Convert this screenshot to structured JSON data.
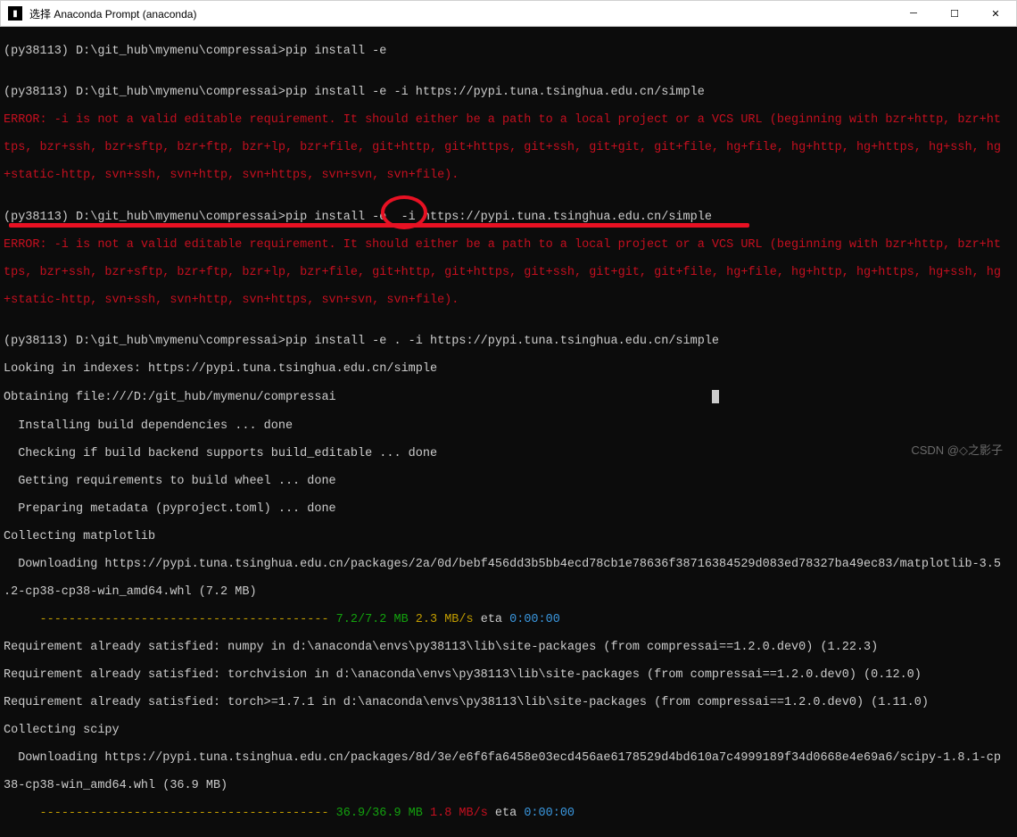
{
  "window": {
    "title": "选择 Anaconda Prompt (anaconda)",
    "icon_glyph": "▮"
  },
  "controls": {
    "min": "─",
    "max": "☐",
    "close": "✕"
  },
  "terminal": {
    "prompt1": "(py38113) D:\\git_hub\\mymenu\\compressai>pip install -e",
    "blank1": "",
    "prompt2": "(py38113) D:\\git_hub\\mymenu\\compressai>pip install -e -i https://pypi.tuna.tsinghua.edu.cn/simple",
    "error1a": "ERROR: -i is not a valid editable requirement. It should either be a path to a local project or a VCS URL (beginning with bzr+http, bzr+ht",
    "error1b": "tps, bzr+ssh, bzr+sftp, bzr+ftp, bzr+lp, bzr+file, git+http, git+https, git+ssh, git+git, git+file, hg+file, hg+http, hg+https, hg+ssh, hg",
    "error1c": "+static-http, svn+ssh, svn+http, svn+https, svn+svn, svn+file).",
    "blank2": "",
    "prompt3": "(py38113) D:\\git_hub\\mymenu\\compressai>pip install -e  -i https://pypi.tuna.tsinghua.edu.cn/simple",
    "error2a": "ERROR: -i is not a valid editable requirement. It should either be a path to a local project or a VCS URL (beginning with bzr+http, bzr+ht",
    "error2b": "tps, bzr+ssh, bzr+sftp, bzr+ftp, bzr+lp, bzr+file, git+http, git+https, git+ssh, git+git, git+file, hg+file, hg+http, hg+https, hg+ssh, hg",
    "error2c": "+static-http, svn+ssh, svn+http, svn+https, svn+svn, svn+file).",
    "blank3": "",
    "prompt4": "(py38113) D:\\git_hub\\mymenu\\compressai>pip install -e . -i https://pypi.tuna.tsinghua.edu.cn/simple",
    "looking": "Looking in indexes: https://pypi.tuna.tsinghua.edu.cn/simple",
    "obtain": "Obtaining file:///D:/git_hub/mymenu/compressai",
    "install_dep": "  Installing build dependencies ... done",
    "check_backend": "  Checking if build backend supports build_editable ... done",
    "get_req": "  Getting requirements to build wheel ... done",
    "prep_meta": "  Preparing metadata (pyproject.toml) ... done",
    "collect_mpl": "Collecting matplotlib",
    "download_mpl1": "  Downloading https://pypi.tuna.tsinghua.edu.cn/packages/2a/0d/bebf456dd3b5bb4ecd78cb1e78636f38716384529d083ed78327ba49ec83/matplotlib-3.5",
    "download_mpl2": ".2-cp38-cp38-win_amd64.whl (7.2 MB)",
    "progress1_pre": "     ",
    "progress1_dashes": "---------------------------------------- ",
    "progress1_size": "7.2/7.2 MB ",
    "progress1_speed": "2.3 MB/s ",
    "progress1_eta_label": "eta ",
    "progress1_eta": "0:00:00",
    "req_numpy": "Requirement already satisfied: numpy in d:\\anaconda\\envs\\py38113\\lib\\site-packages (from compressai==1.2.0.dev0) (1.22.3)",
    "req_tv": "Requirement already satisfied: torchvision in d:\\anaconda\\envs\\py38113\\lib\\site-packages (from compressai==1.2.0.dev0) (0.12.0)",
    "req_torch": "Requirement already satisfied: torch>=1.7.1 in d:\\anaconda\\envs\\py38113\\lib\\site-packages (from compressai==1.2.0.dev0) (1.11.0)",
    "collect_scipy": "Collecting scipy",
    "download_scipy1": "  Downloading https://pypi.tuna.tsinghua.edu.cn/packages/8d/3e/e6f6fa6458e03ecd456ae6178529d4bd610a7c4999189f34d0668e4e69a6/scipy-1.8.1-cp",
    "download_scipy2": "38-cp38-win_amd64.whl (36.9 MB)",
    "progress2_pre": "     ",
    "progress2_dashes": "---------------------------------------- ",
    "progress2_size": "36.9/36.9 MB ",
    "progress2_speed": "1.8 MB/s ",
    "progress2_eta_label": "eta ",
    "progress2_eta": "0:00:00"
  },
  "watermark": "CSDN @◇之影子"
}
